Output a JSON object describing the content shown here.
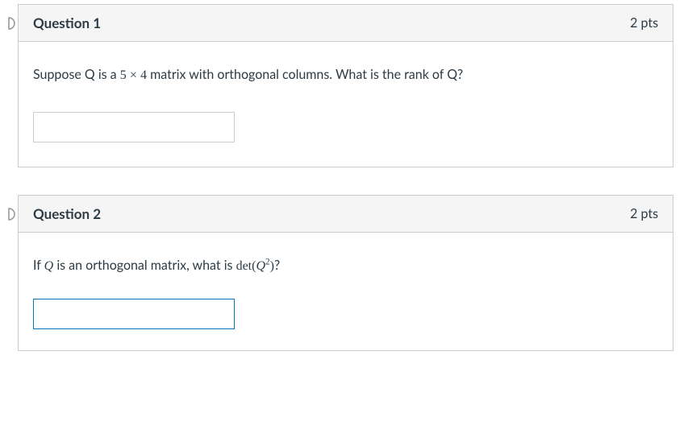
{
  "questions": [
    {
      "title": "Question 1",
      "points": "2 pts",
      "prompt_prefix": "Suppose Q is a ",
      "matrix_a": "5",
      "matrix_times": "×",
      "matrix_b": "4",
      "prompt_suffix": " matrix with orthogonal columns.  What is the rank of Q?",
      "input_value": "",
      "input_focused": false
    },
    {
      "title": "Question 2",
      "points": "2 pts",
      "prompt_prefix": "If ",
      "q_var": "Q",
      "prompt_mid": " is an orthogonal matrix, what is ",
      "det_label": "det",
      "det_open": "(",
      "det_var": "Q",
      "det_exp": "2",
      "det_close": ")",
      "prompt_suffix": "?",
      "input_value": "",
      "input_focused": true
    }
  ]
}
